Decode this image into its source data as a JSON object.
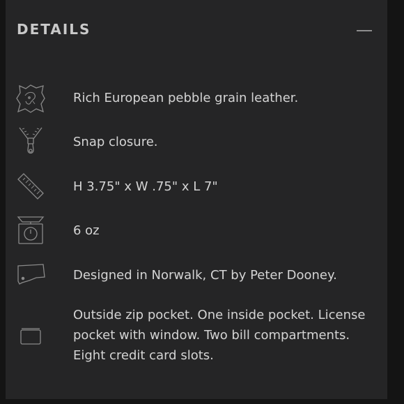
{
  "details": {
    "title": "DETAILS",
    "collapse_icon": "minus-icon",
    "items": [
      {
        "icon": "leather-hide-icon",
        "text": "Rich European pebble grain leather."
      },
      {
        "icon": "zipper-icon",
        "text": "Snap closure."
      },
      {
        "icon": "ruler-icon",
        "text": "H 3.75\" x W .75\" x L 7\""
      },
      {
        "icon": "scale-icon",
        "text": "6 oz"
      },
      {
        "icon": "connecticut-map-icon",
        "text": "Designed in Norwalk, CT by Peter Dooney."
      },
      {
        "icon": "pocket-icon",
        "text": "Outside zip pocket. One inside pocket. License pocket with window. Two bill compartments. Eight credit card slots."
      }
    ]
  },
  "colors": {
    "background": "#141414",
    "panel": "#252526",
    "text": "#d4d4d4",
    "icon": "#8a8a8a"
  }
}
